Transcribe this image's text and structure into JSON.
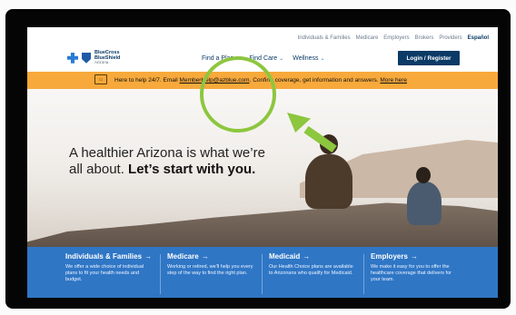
{
  "top_links": [
    "Individuals & Families",
    "Medicare",
    "Employers",
    "Brokers",
    "Providers",
    "Español"
  ],
  "logo": {
    "line1": "BlueCross",
    "line2": "BlueShield",
    "line3": "Arizona"
  },
  "nav": {
    "items": [
      "Find a Plan",
      "Find Care",
      "Wellness"
    ],
    "login": "Login / Register"
  },
  "banner": {
    "text_prefix": "Here to help 24/7. Email ",
    "email": "MemberHelp@azblue.com",
    "text_suffix": ". Confirm coverage, get information and answers. ",
    "link": "More here"
  },
  "hero": {
    "line1": "A healthier Arizona is what we’re",
    "line2_plain": "all about. ",
    "line2_bold": "Let’s start with you."
  },
  "cards": [
    {
      "title": "Individuals & Families",
      "text": "We offer a wide choice of individual plans to fit your health needs and budget."
    },
    {
      "title": "Medicare",
      "text": "Working or retired, we'll help you every step of the way to find the right plan."
    },
    {
      "title": "Medicaid",
      "text": "Our Health Choice plans are available to Arizonans who qualify for Medicaid."
    },
    {
      "title": "Employers",
      "text": "We make it easy for you to offer the healthcare coverage that delivers for your team."
    }
  ],
  "colors": {
    "accent": "#2f76c5",
    "banner": "#f7a93b",
    "highlight": "#8dc63f",
    "navy": "#0b3a66"
  }
}
